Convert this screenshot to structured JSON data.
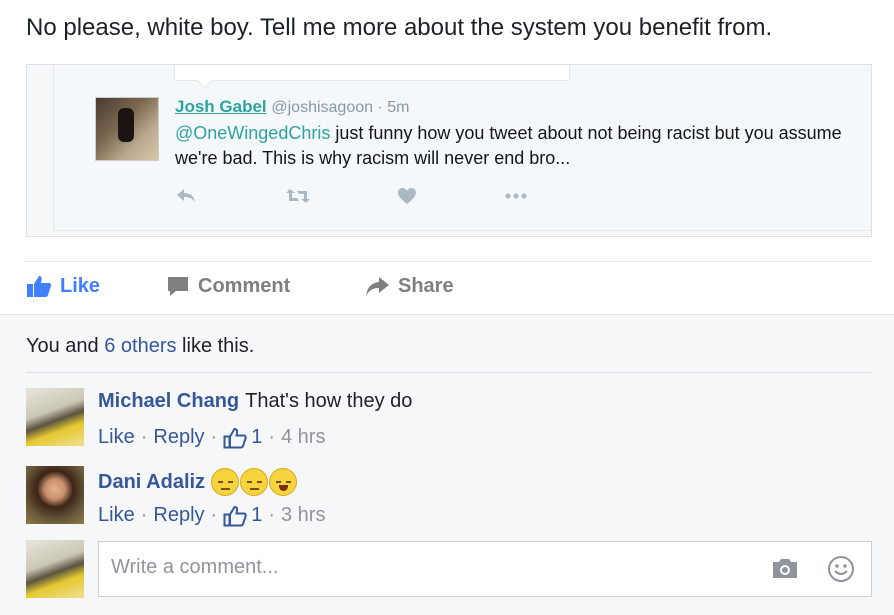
{
  "post": {
    "text": "No please, white boy. Tell me more about the system you benefit from."
  },
  "tweet": {
    "name": "Josh Gabel",
    "handle": "@joshisagoon · 5m",
    "mention": "@OneWingedChris",
    "body": " just funny how you tweet about not being racist but you assume we're bad. This is why racism will never end bro...",
    "icons": [
      "reply-icon",
      "retweet-icon",
      "heart-icon",
      "more-icon"
    ]
  },
  "actions": {
    "like": "Like",
    "comment": "Comment",
    "share": "Share"
  },
  "likes": {
    "prefix": "You and ",
    "others": "6 others",
    "suffix": " like this."
  },
  "comments": [
    {
      "name": "Michael Chang",
      "text": "That's how they do",
      "like": "Like",
      "reply": "Reply",
      "count": "1",
      "time": "4 hrs"
    },
    {
      "name": "Dani Adaliz",
      "text": "",
      "like": "Like",
      "reply": "Reply",
      "count": "1",
      "time": "3 hrs"
    }
  ],
  "write": {
    "placeholder": "Write a comment..."
  },
  "colors": {
    "link": "#365899",
    "like_blue": "#4080ff",
    "twitter_teal": "#2ea4a0"
  }
}
